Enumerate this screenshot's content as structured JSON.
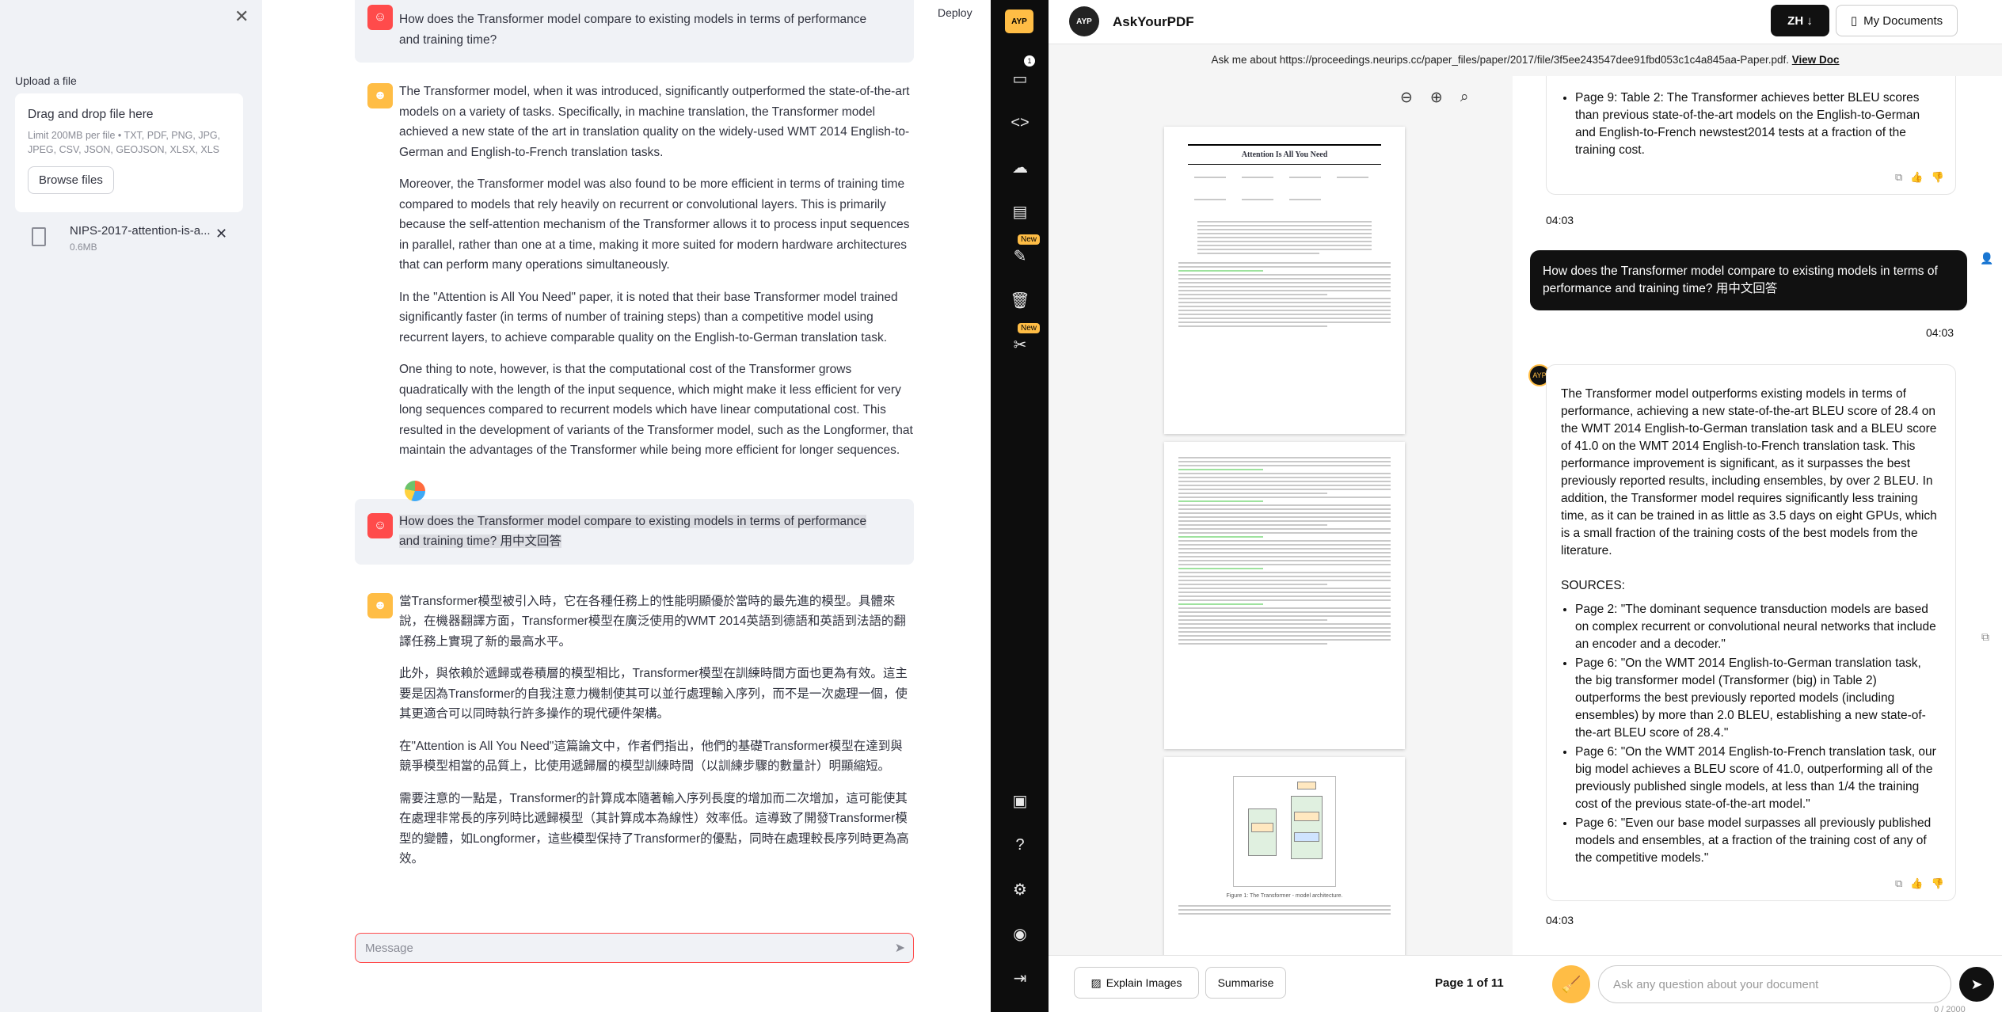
{
  "sidebar": {
    "upload_label": "Upload a file",
    "drop_title": "Drag and drop file here",
    "drop_limit": "Limit 200MB per file • TXT, PDF, PNG, JPG, JPEG, CSV, JSON, GEOJSON, XLSX, XLS",
    "browse_label": "Browse files",
    "file_name": "NIPS-2017-attention-is-a...",
    "file_size": "0.6MB"
  },
  "main": {
    "deploy_label": "Deploy",
    "messages": [
      {
        "role": "user",
        "text": "How does the Transformer model compare to existing models in terms of performance and training time?"
      },
      {
        "role": "assistant",
        "paragraphs": [
          "The Transformer model, when it was introduced, significantly outperformed the state-of-the-art models on a variety of tasks. Specifically, in machine translation, the Transformer model achieved a new state of the art in translation quality on the widely-used WMT 2014 English-to-German and English-to-French translation tasks.",
          "Moreover, the Transformer model was also found to be more efficient in terms of training time compared to models that rely heavily on recurrent or convolutional layers. This is primarily because the self-attention mechanism of the Transformer allows it to process input sequences in parallel, rather than one at a time, making it more suited for modern hardware architectures that can perform many operations simultaneously.",
          "In the \"Attention is All You Need\" paper, it is noted that their base Transformer model trained significantly faster (in terms of number of training steps) than a competitive model using recurrent layers, to achieve comparable quality on the English-to-German translation task.",
          "One thing to note, however, is that the computational cost of the Transformer grows quadratically with the length of the input sequence, which might make it less efficient for very long sequences compared to recurrent models which have linear computational cost. This resulted in the development of variants of the Transformer model, such as the Longformer, that maintain the advantages of the Transformer while being more efficient for longer sequences."
        ]
      },
      {
        "role": "user",
        "text": "How does the Transformer model compare to existing models in terms of performance and training time? 用中文回答"
      },
      {
        "role": "assistant",
        "paragraphs": [
          "當Transformer模型被引入時，它在各種任務上的性能明顯優於當時的最先進的模型。具體來說，在機器翻譯方面，Transformer模型在廣泛使用的WMT 2014英語到德語和英語到法語的翻譯任務上實現了新的最高水平。",
          "此外，與依賴於遞歸或卷積層的模型相比，Transformer模型在訓練時間方面也更為有效。這主要是因為Transformer的自我注意力機制使其可以並行處理輸入序列，而不是一次處理一個，使其更適合可以同時執行許多操作的現代硬件架構。",
          "在\"Attention is All You Need\"這篇論文中，作者們指出，他們的基礎Transformer模型在達到與競爭模型相當的品質上，比使用遞歸層的模型訓練時間（以訓練步驟的數量計）明顯縮短。",
          "需要注意的一點是，Transformer的計算成本隨著輸入序列長度的增加而二次增加，這可能使其在處理非常長的序列時比遞歸模型（其計算成本為線性）效率低。這導致了開發Transformer模型的變體，如Longformer，這些模型保持了Transformer的優點，同時在處理較長序列時更為高效。"
        ]
      }
    ],
    "input_placeholder": "Message"
  },
  "rail": {
    "logo_text": "AYP",
    "badge_count": "1",
    "new_label": "New"
  },
  "ext": {
    "logo_text": "AYP",
    "title": "AskYourPDF",
    "lang": "ZH",
    "docs_label": "My Documents",
    "ask_prefix": "Ask me about https://proceedings.neurips.cc/paper_files/paper/2017/file/3f5ee243547dee91fbd053c1c4a845aa-Paper.pdf.",
    "view_doc": "View Doc",
    "pdf_title": "Attention Is All You Need",
    "pdf_caption": "Figure 1: The Transformer - model architecture.",
    "chat": {
      "prev_bullet": "Page 9: Table 2: The Transformer achieves better BLEU scores than previous state-of-the-art models on the English-to-German and English-to-French newstest2014 tests at a fraction of the training cost.",
      "time1": "04:03",
      "user_q": "How does the Transformer model compare to existing models in terms of performance and training time? 用中文回答",
      "time2": "04:03",
      "answer": "The Transformer model outperforms existing models in terms of performance, achieving a new state-of-the-art BLEU score of 28.4 on the WMT 2014 English-to-German translation task and a BLEU score of 41.0 on the WMT 2014 English-to-French translation task. This performance improvement is significant, as it surpasses the best previously reported results, including ensembles, by over 2 BLEU. In addition, the Transformer model requires significantly less training time, as it can be trained in as little as 3.5 days on eight GPUs, which is a small fraction of the training costs of the best models from the literature.",
      "sources_label": "SOURCES:",
      "sources": [
        "Page 2: \"The dominant sequence transduction models are based on complex recurrent or convolutional neural networks that include an encoder and a decoder.\"",
        "Page 6: \"On the WMT 2014 English-to-German translation task, the big transformer model (Transformer (big) in Table 2) outperforms the best previously reported models (including ensembles) by more than 2.0 BLEU, establishing a new state-of-the-art BLEU score of 28.4.\"",
        "Page 6: \"On the WMT 2014 English-to-French translation task, our big model achieves a BLEU score of 41.0, outperforming all of the previously published single models, at less than 1/4 the training cost of the previous state-of-the-art model.\"",
        "Page 6: \"Even our base model surpasses all previously published models and ensembles, at a fraction of the training cost of any of the competitive models.\""
      ],
      "time3": "04:03"
    },
    "footer": {
      "explain_label": "Explain Images",
      "summarise_label": "Summarise",
      "page_indicator": "Page 1 of 11",
      "input_placeholder": "Ask any question about your document",
      "counter": "0 / 2000"
    }
  }
}
